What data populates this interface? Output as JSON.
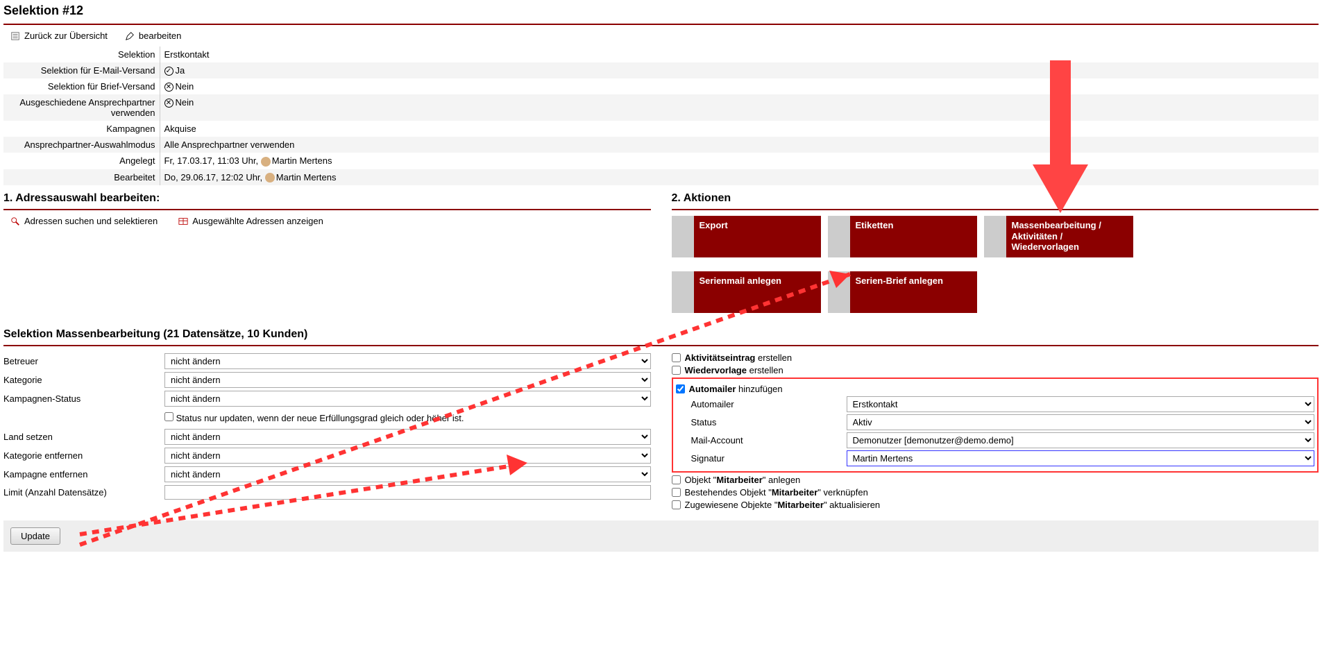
{
  "title": "Selektion #12",
  "toolbar": {
    "back": "Zurück zur Übersicht",
    "edit": "bearbeiten"
  },
  "details": {
    "selektion": {
      "label": "Selektion",
      "value": "Erstkontakt"
    },
    "email": {
      "label": "Selektion für E-Mail-Versand",
      "value": "Ja"
    },
    "brief": {
      "label": "Selektion für Brief-Versand",
      "value": "Nein"
    },
    "ausgeschieden": {
      "label": "Ausgeschiedene Ansprechpartner verwenden",
      "value": "Nein"
    },
    "kampagnen": {
      "label": "Kampagnen",
      "value": "Akquise"
    },
    "modus": {
      "label": "Ansprechpartner-Auswahlmodus",
      "value": "Alle Ansprechpartner verwenden"
    },
    "angelegt": {
      "label": "Angelegt",
      "date": "Fr, 17.03.17, 11:03 Uhr,",
      "user": "Martin Mertens"
    },
    "bearbeitet": {
      "label": "Bearbeitet",
      "date": "Do, 29.06.17, 12:02 Uhr,",
      "user": "Martin Mertens"
    }
  },
  "section1": {
    "title": "1. Adressauswahl bearbeiten:",
    "search": "Adressen suchen und selektieren",
    "show": "Ausgewählte Adressen anzeigen"
  },
  "section2": {
    "title": "2. Aktionen",
    "tiles": {
      "export": "Export",
      "etiketten": "Etiketten",
      "mass": "Massenbearbeitung / Aktivitäten / Wiedervorlagen",
      "serienmail": "Serienmail anlegen",
      "serienbrief": "Serien-Brief anlegen"
    }
  },
  "mass": {
    "title": "Selektion Massenbearbeitung (21 Datensätze, 10 Kunden)",
    "betreuer": {
      "label": "Betreuer",
      "value": "nicht ändern"
    },
    "kategorie": {
      "label": "Kategorie",
      "value": "nicht ändern"
    },
    "kampstatus": {
      "label": "Kampagnen-Status",
      "value": "nicht ändern"
    },
    "statushint": "Status nur updaten, wenn der neue Erfüllungsgrad gleich oder höher ist.",
    "land": {
      "label": "Land setzen",
      "value": "nicht ändern"
    },
    "katentf": {
      "label": "Kategorie entfernen",
      "value": "nicht ändern"
    },
    "kampentf": {
      "label": "Kampagne entfernen",
      "value": "nicht ändern"
    },
    "limit": {
      "label": "Limit (Anzahl Datensätze)"
    }
  },
  "right_checks": {
    "aktivitaet": {
      "bold": "Aktivitätseintrag",
      "rest": " erstellen"
    },
    "wiedervorlage": {
      "bold": "Wiedervorlage",
      "rest": " erstellen"
    },
    "automailer": {
      "bold": "Automailer",
      "rest": " hinzufügen"
    },
    "am": {
      "automailer": {
        "label": "Automailer",
        "value": "Erstkontakt"
      },
      "status": {
        "label": "Status",
        "value": "Aktiv"
      },
      "account": {
        "label": "Mail-Account",
        "value": "Demonutzer [demonutzer@demo.demo]"
      },
      "signatur": {
        "label": "Signatur",
        "value": "Martin Mertens"
      }
    },
    "obj_anlegen": {
      "pre": "Objekt \"",
      "bold": "Mitarbeiter",
      "post": "\" anlegen"
    },
    "obj_link": {
      "pre": "Bestehendes Objekt \"",
      "bold": "Mitarbeiter",
      "post": "\" verknüpfen"
    },
    "obj_update": {
      "pre": "Zugewiesene Objekte \"",
      "bold": "Mitarbeiter",
      "post": "\" aktualisieren"
    }
  },
  "footer": {
    "update": "Update"
  }
}
